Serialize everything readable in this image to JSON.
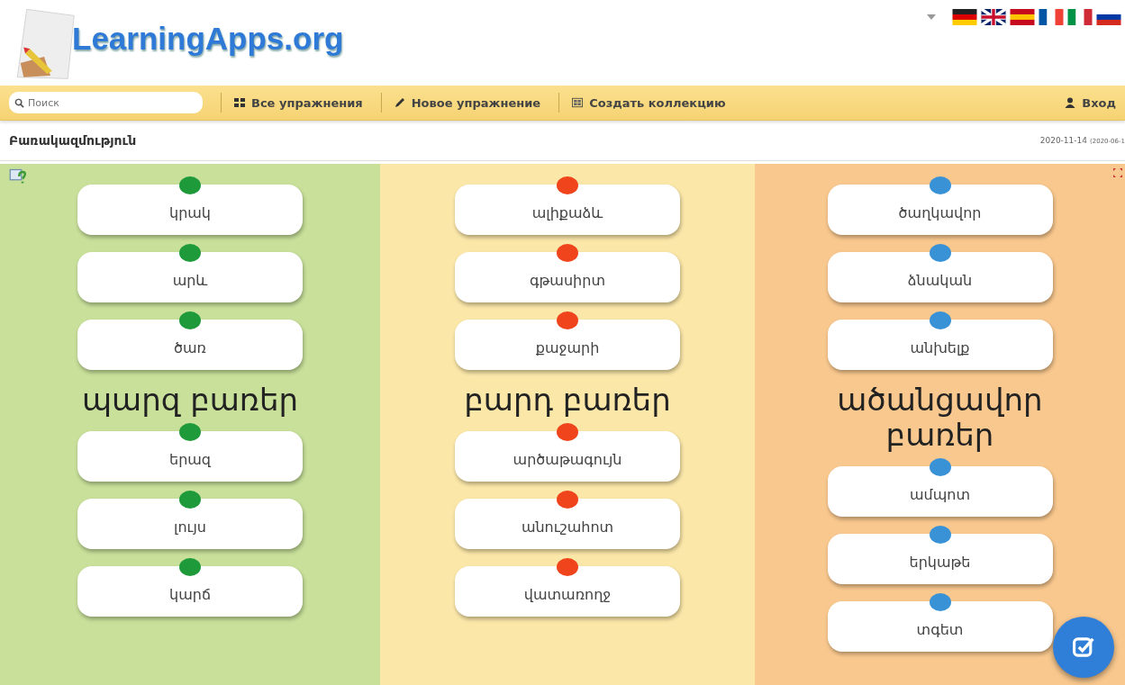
{
  "header": {
    "logo": "LearningApps.org"
  },
  "nav": {
    "search": {
      "placeholder": "Поиск"
    },
    "links": [
      {
        "label": "Все упражнения"
      },
      {
        "label": "Новое упражнение"
      },
      {
        "label": "Создать коллекцию"
      }
    ],
    "login": "Вход"
  },
  "app": {
    "title": "Բառակազմություն",
    "date": "2020-11-14",
    "date_extra": "(2020-06-1"
  },
  "columns": [
    {
      "title": "պարզ բառեր",
      "color": "#1f9a3a",
      "top": [
        "կրակ",
        "արև",
        "ծառ"
      ],
      "bottom": [
        "երազ",
        "լույս",
        "կարճ"
      ]
    },
    {
      "title": "բարդ բառեր",
      "color": "#f0441c",
      "top": [
        "ալիքաձև",
        "գթասիրտ",
        "քաջարի"
      ],
      "bottom": [
        "արծաթագույն",
        "անուշահոտ",
        "վատառողջ"
      ]
    },
    {
      "title": "ածանցավոր բառեր",
      "color": "#3a92d6",
      "top": [
        "ծաղկավոր",
        "ձնական",
        "անխելք"
      ],
      "bottom": [
        "ամպոտ",
        "երկաթե",
        "տգետ"
      ]
    }
  ]
}
